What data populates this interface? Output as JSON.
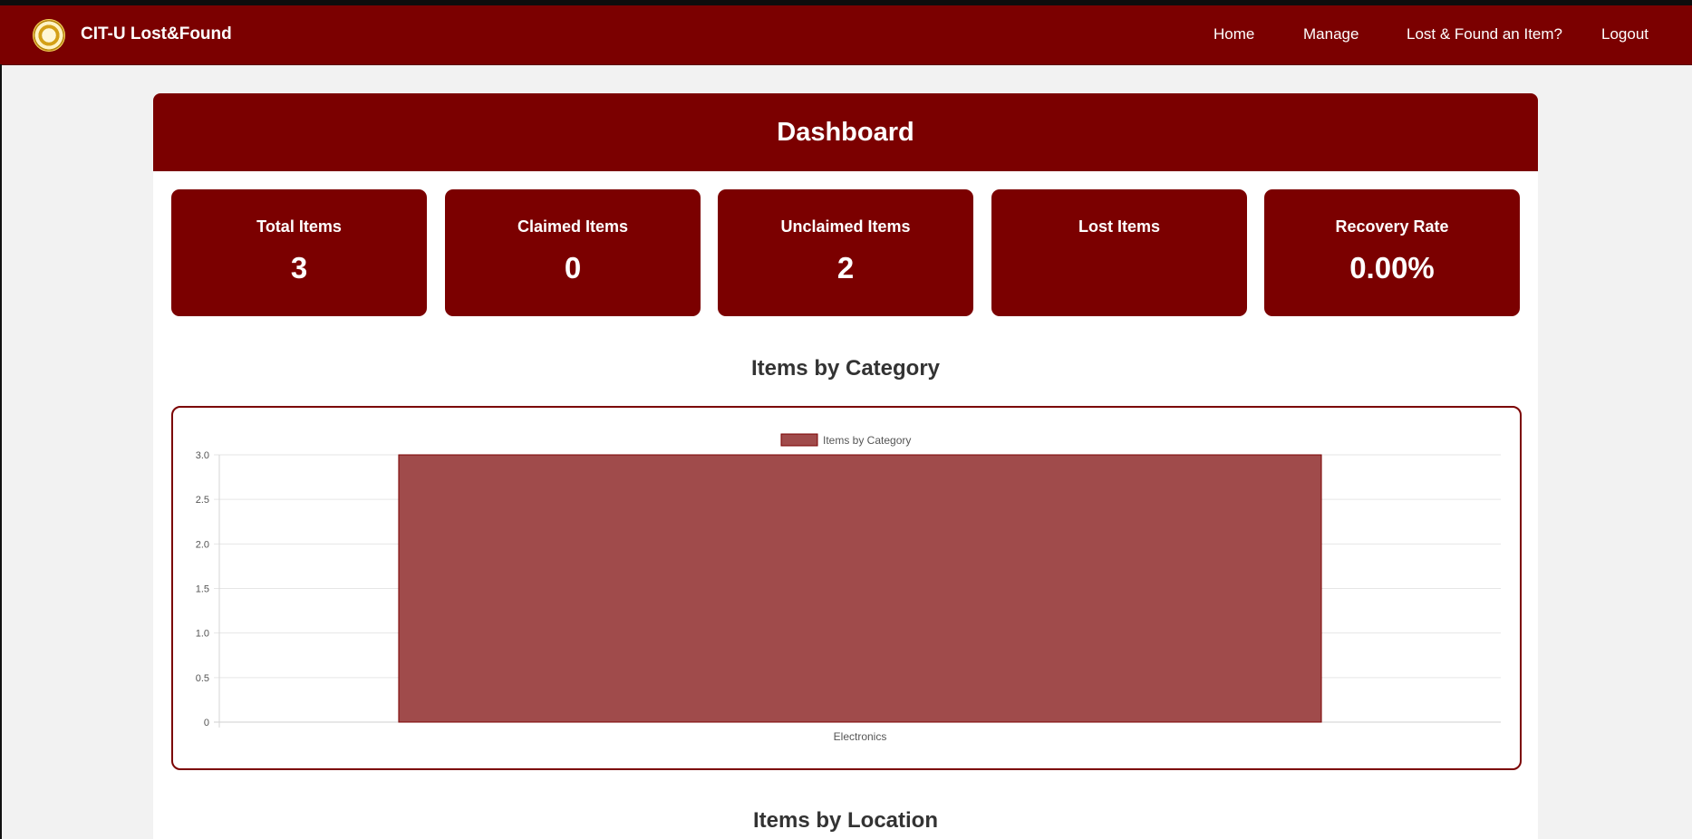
{
  "app": {
    "brand": "CIT-U Lost&Found"
  },
  "nav": {
    "home": "Home",
    "manage": "Manage",
    "lost_found": "Lost & Found an Item?",
    "logout": "Logout"
  },
  "dashboard": {
    "title": "Dashboard"
  },
  "stats": [
    {
      "label": "Total Items",
      "value": "3"
    },
    {
      "label": "Claimed Items",
      "value": "0"
    },
    {
      "label": "Unclaimed Items",
      "value": "2"
    },
    {
      "label": "Lost Items",
      "value": ""
    },
    {
      "label": "Recovery Rate",
      "value": "0.00%"
    }
  ],
  "sections": {
    "category_title": "Items by Category",
    "location_title": "Items by Location"
  },
  "colors": {
    "primary": "#7b0000",
    "bar_fill": "#a04b4b",
    "bar_stroke": "#7b0000"
  },
  "chart_data": {
    "type": "bar",
    "categories": [
      "Electronics"
    ],
    "series": [
      {
        "name": "Items by Category",
        "values": [
          3
        ]
      }
    ],
    "yticks": [
      "0",
      "0.5",
      "1.0",
      "1.5",
      "2.0",
      "2.5",
      "3.0"
    ],
    "ylim": [
      0,
      3
    ],
    "grid": true,
    "legend": "top-center"
  }
}
